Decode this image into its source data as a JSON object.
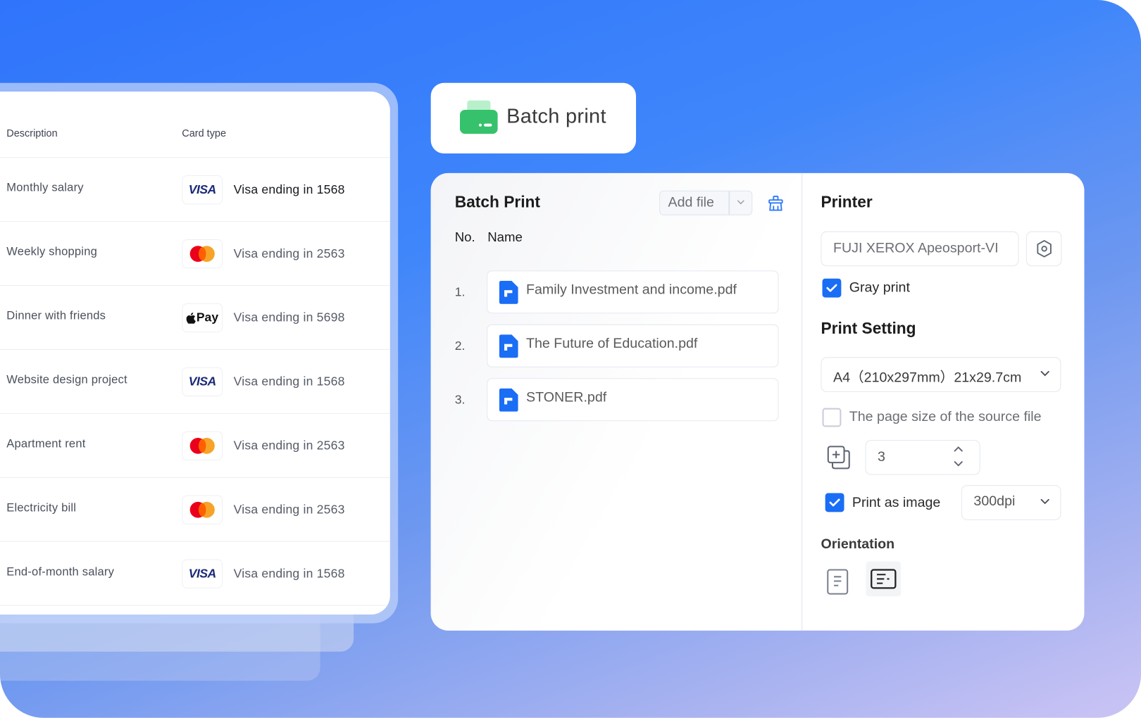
{
  "transactions": {
    "headers": {
      "description": "Description",
      "card_type": "Card type"
    },
    "rows": [
      {
        "description": "Monthly salary",
        "card_logo": "visa",
        "logo_text": "VISA",
        "card_text": "Visa ending in 1568",
        "emphasis": true
      },
      {
        "description": "Weekly shopping",
        "card_logo": "mastercard",
        "logo_text": "",
        "card_text": "Visa ending in 2563",
        "emphasis": false
      },
      {
        "description": "Dinner with friends",
        "card_logo": "apple-pay",
        "logo_text": "Pay",
        "card_text": "Visa ending in 5698",
        "emphasis": false
      },
      {
        "description": "Website design project",
        "card_logo": "visa",
        "logo_text": "VISA",
        "card_text": "Visa ending in 1568",
        "emphasis": false
      },
      {
        "description": "Apartment rent",
        "card_logo": "mastercard",
        "logo_text": "",
        "card_text": "Visa ending in 2563",
        "emphasis": false
      },
      {
        "description": "Electricity bill",
        "card_logo": "mastercard",
        "logo_text": "",
        "card_text": "Visa ending in 2563",
        "emphasis": false
      },
      {
        "description": "End-of-month salary",
        "card_logo": "visa",
        "logo_text": "VISA",
        "card_text": "Visa ending in 1568",
        "emphasis": false
      }
    ]
  },
  "chip": {
    "label": "Batch print",
    "icon": "printer-icon"
  },
  "batch": {
    "title": "Batch Print",
    "add_file_label": "Add file",
    "clean_icon": "broom-icon",
    "col_no": "No.",
    "col_name": "Name",
    "files": [
      {
        "no": "1.",
        "name": "Family Investment and income.pdf"
      },
      {
        "no": "2.",
        "name": "The Future of Education.pdf"
      },
      {
        "no": "3.",
        "name": "STONER.pdf"
      }
    ]
  },
  "printer": {
    "title": "Printer",
    "printer_name": "FUJI XEROX Apeosport-VI",
    "gray_print_label": "Gray print",
    "gray_print_checked": true
  },
  "print_setting": {
    "title": "Print Setting",
    "paper_size": "A4（210x297mm）21x29.7cm",
    "source_page_size_label": "The page size of the source file",
    "source_page_size_checked": false,
    "copies": "3",
    "print_as_image_label": "Print as image",
    "print_as_image_checked": true,
    "dpi": "300dpi",
    "orientation_label": "Orientation",
    "orientation_selected": "landscape"
  },
  "colors": {
    "accent": "#1a6df5",
    "chip_green": "#36c26c",
    "bg_top": "#2f74fb",
    "bg_bottom": "#cbc4f5"
  }
}
